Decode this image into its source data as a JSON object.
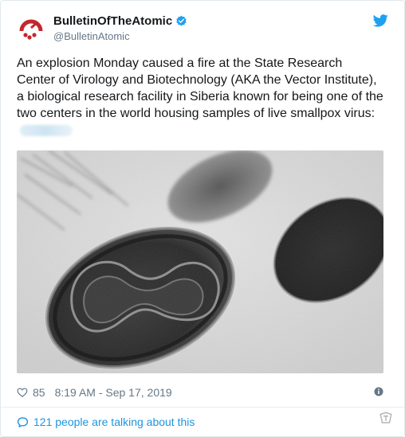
{
  "account": {
    "display_name": "BulletinOfTheAtomic",
    "handle": "@BulletinAtomic"
  },
  "tweet": {
    "text": "An explosion Monday caused a fire at the State Research Center of Virology and Biotechnology (AKA the Vector Institute), a biological research facility in Siberia known for being one of the two centers in the world housing samples of live smallpox virus:"
  },
  "stats": {
    "likes": "85",
    "timestamp": "8:19 AM - Sep 17, 2019"
  },
  "conversation": {
    "label": "121 people are talking about this"
  },
  "icons": {
    "avatar": "bulletin-clock-logo",
    "verified": "verified-badge-icon",
    "brand": "twitter-bird-icon",
    "like": "heart-icon",
    "info": "info-icon",
    "reply": "speech-bubble-icon"
  },
  "colors": {
    "accent": "#1da1f2",
    "link": "#1b95e0",
    "muted": "#657786",
    "avatar_red": "#c4272f"
  }
}
